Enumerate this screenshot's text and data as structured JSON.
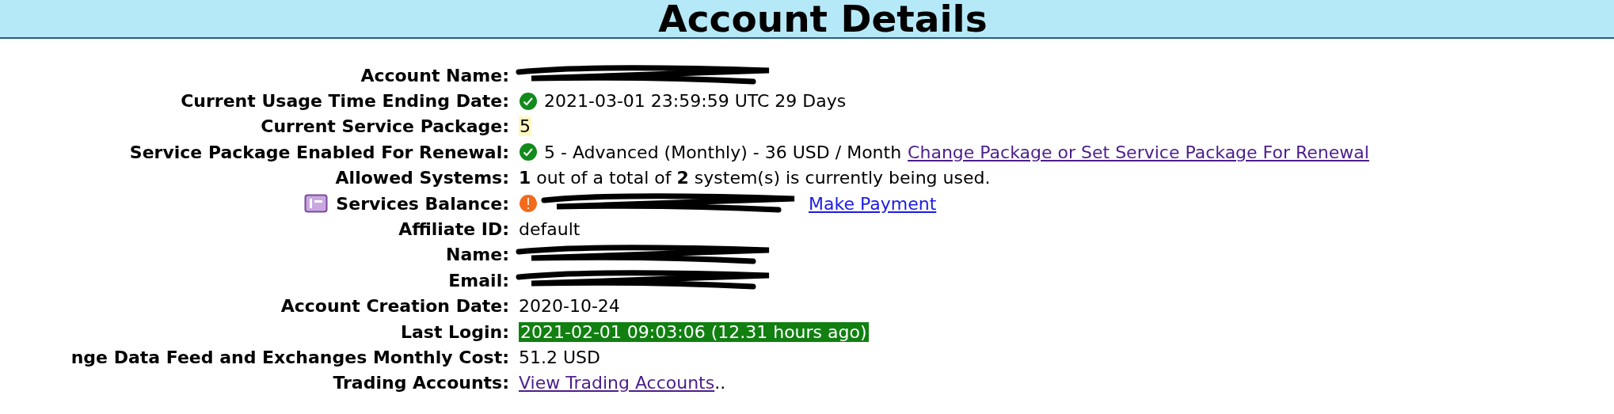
{
  "title": "Account Details",
  "rows": [
    {
      "label": "Account Name:",
      "value": [
        {
          "kind": "redacted"
        }
      ]
    },
    {
      "label": "Current Usage Time Ending Date:",
      "value": [
        {
          "kind": "check"
        },
        {
          "kind": "text",
          "text": "2021-03-01 23:59:59 UTC 29 Days"
        }
      ]
    },
    {
      "label": "Current Service Package:",
      "value": [
        {
          "kind": "highlight",
          "text": "5"
        }
      ]
    },
    {
      "label": "Service Package Enabled For Renewal:",
      "value": [
        {
          "kind": "check"
        },
        {
          "kind": "text",
          "text": "5 - Advanced (Monthly) - 36 USD / Month"
        },
        {
          "kind": "link",
          "visited": true,
          "text": "Change Package or Set Service Package For Renewal"
        }
      ]
    },
    {
      "label": "Allowed Systems:",
      "value": [
        {
          "kind": "text",
          "text": "**1** out of a total of **2** system(s) is currently being used."
        }
      ]
    },
    {
      "label": "Services Balance:",
      "label_icon": true,
      "value": [
        {
          "kind": "alert"
        },
        {
          "kind": "redacted"
        },
        {
          "kind": "link",
          "visited": false,
          "text": "Make Payment"
        }
      ]
    },
    {
      "label": "Affiliate ID:",
      "value": [
        {
          "kind": "text",
          "text": "default"
        }
      ]
    },
    {
      "label": "Name:",
      "value": [
        {
          "kind": "redacted"
        }
      ]
    },
    {
      "label": "Email:",
      "value": [
        {
          "kind": "redacted"
        }
      ]
    },
    {
      "label": "Account Creation Date:",
      "value": [
        {
          "kind": "text",
          "text": "2020-10-24"
        }
      ]
    },
    {
      "label": "Last Login:",
      "value": [
        {
          "kind": "success",
          "text": "2021-02-01 09:03:06 (12.31 hours ago)"
        }
      ]
    },
    {
      "label": "nge Data Feed and Exchanges Monthly Cost:",
      "value": [
        {
          "kind": "text",
          "text": "51.2 USD"
        }
      ]
    },
    {
      "label": "Trading Accounts:",
      "value": [
        {
          "kind": "link",
          "visited": true,
          "text": "View Trading Accounts"
        },
        {
          "kind": "tight",
          "text": ".."
        }
      ]
    }
  ]
}
